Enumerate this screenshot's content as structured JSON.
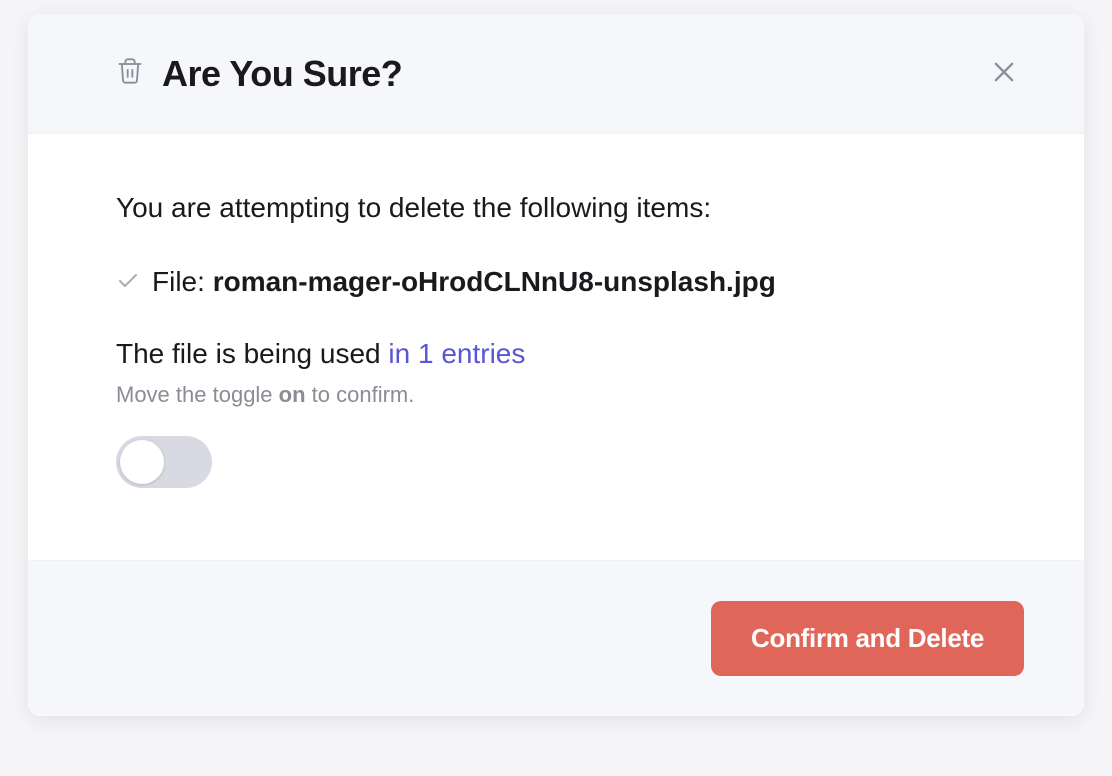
{
  "modal": {
    "title": "Are You Sure?",
    "intro": "You are attempting to delete the following items:",
    "file": {
      "label": "File: ",
      "name": "roman-mager-oHrodCLNnU8-unsplash.jpg"
    },
    "usage": {
      "prefix": "The file is being used ",
      "link": "in 1 entries"
    },
    "hint": {
      "before": "Move the toggle ",
      "bold": "on",
      "after": " to confirm."
    },
    "confirm_button": "Confirm and Delete"
  }
}
